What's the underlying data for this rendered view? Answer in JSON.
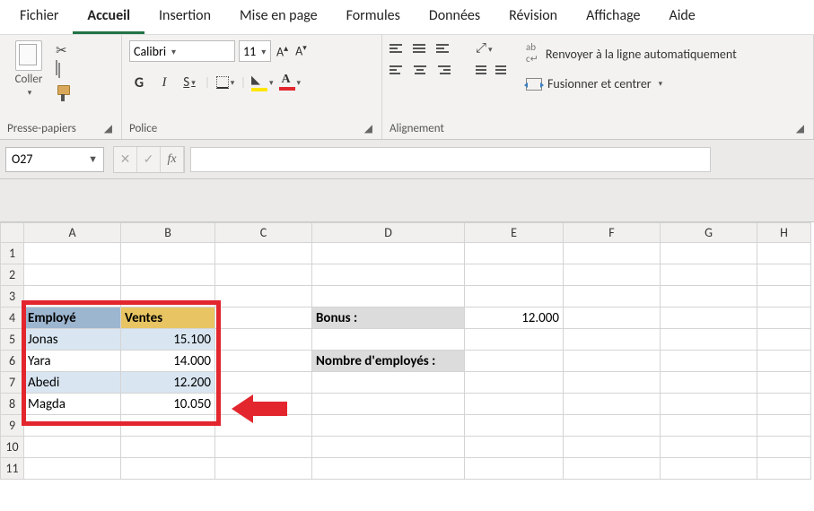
{
  "menu": {
    "file": "Fichier",
    "home": "Accueil",
    "insert": "Insertion",
    "layout": "Mise en page",
    "formulas": "Formules",
    "data": "Données",
    "review": "Révision",
    "view": "Affichage",
    "help": "Aide"
  },
  "ribbon": {
    "clipboard": {
      "paste": "Coller",
      "label": "Presse-papiers"
    },
    "font": {
      "name": "Calibri",
      "size": "11",
      "bold": "G",
      "italic": "I",
      "underline": "S",
      "label": "Police"
    },
    "align": {
      "wrap": "Renvoyer à la ligne automatiquement",
      "merge": "Fusionner et centrer",
      "label": "Alignement"
    }
  },
  "namebox": "O27",
  "columns": [
    "A",
    "B",
    "C",
    "D",
    "E",
    "F",
    "G",
    "H"
  ],
  "rows": [
    "1",
    "2",
    "3",
    "4",
    "5",
    "6",
    "7",
    "8",
    "9",
    "10",
    "11"
  ],
  "sheet": {
    "header_emp": "Employé",
    "header_sales": "Ventes",
    "bonus_label": "Bonus :",
    "bonus_value": "12.000",
    "count_label": "Nombre d'employés :",
    "employees": [
      {
        "name": "Jonas",
        "sales": "15.100"
      },
      {
        "name": "Yara",
        "sales": "14.000"
      },
      {
        "name": "Abedi",
        "sales": "12.200"
      },
      {
        "name": "Magda",
        "sales": "10.050"
      }
    ]
  }
}
